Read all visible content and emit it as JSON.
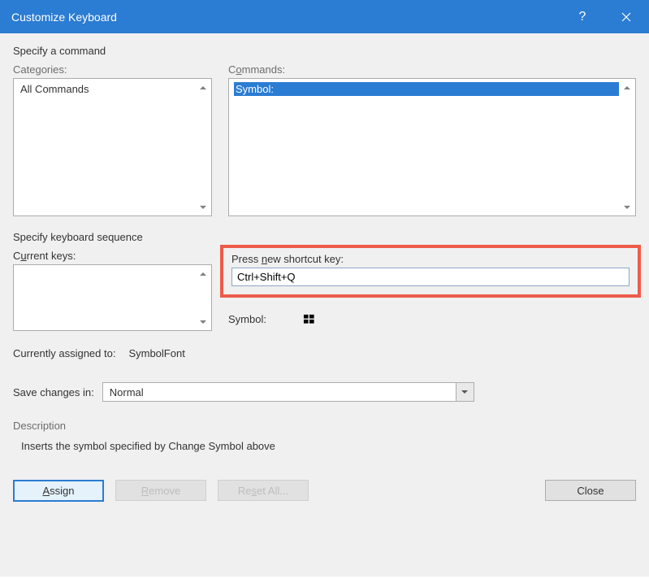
{
  "titlebar": {
    "title": "Customize Keyboard",
    "help": "?"
  },
  "section_specify_command": "Specify a command",
  "categories": {
    "label_pre": "Cate",
    "label_u": "g",
    "label_post": "ories:",
    "items": [
      "All Commands"
    ]
  },
  "commands": {
    "label_pre": "C",
    "label_u": "o",
    "label_post": "mmands:",
    "items": [
      "Symbol:"
    ]
  },
  "section_specify_sequence": "Specify keyboard sequence",
  "current_keys": {
    "label_pre": "C",
    "label_u": "u",
    "label_post": "rrent keys:"
  },
  "new_shortcut": {
    "label_pre": "Press ",
    "label_u": "n",
    "label_post": "ew shortcut key:",
    "value": "Ctrl+Shift+Q"
  },
  "symbol_label": "Symbol:",
  "assigned": {
    "label": "Currently assigned to:",
    "value": "SymbolFont"
  },
  "save_in": {
    "label_pre": "Sa",
    "label_u": "v",
    "label_post": "e changes in:",
    "value": "Normal"
  },
  "description": {
    "label": "Description",
    "text": "Inserts the symbol specified by Change Symbol above"
  },
  "buttons": {
    "assign_u": "A",
    "assign_post": "ssign",
    "remove_u": "R",
    "remove_post": "emove",
    "reset_pre": "Re",
    "reset_u": "s",
    "reset_post": "et All...",
    "close": "Close"
  }
}
